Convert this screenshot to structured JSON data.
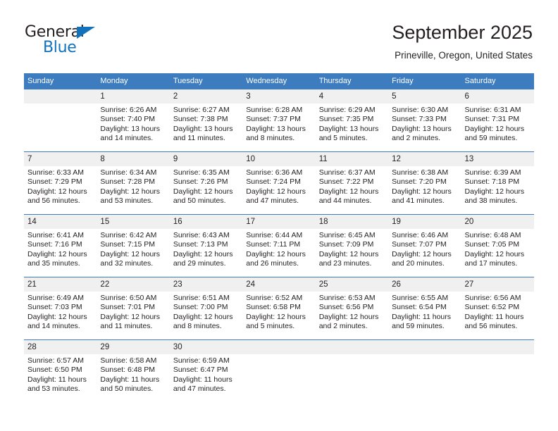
{
  "brand": {
    "name_top": "General",
    "name_bottom": "Blue",
    "accent_color": "#1272bc"
  },
  "header": {
    "title": "September 2025",
    "location": "Prineville, Oregon, United States"
  },
  "theme": {
    "header_bar_color": "#3d7cbe",
    "daynum_band_color": "#f0f0f0",
    "text_color": "#231f20"
  },
  "weekdays": [
    "Sunday",
    "Monday",
    "Tuesday",
    "Wednesday",
    "Thursday",
    "Friday",
    "Saturday"
  ],
  "weeks": [
    [
      {
        "day": "",
        "sunrise": "",
        "sunset": "",
        "daylight_line1": "",
        "daylight_line2": ""
      },
      {
        "day": "1",
        "sunrise": "Sunrise: 6:26 AM",
        "sunset": "Sunset: 7:40 PM",
        "daylight_line1": "Daylight: 13 hours",
        "daylight_line2": "and 14 minutes."
      },
      {
        "day": "2",
        "sunrise": "Sunrise: 6:27 AM",
        "sunset": "Sunset: 7:38 PM",
        "daylight_line1": "Daylight: 13 hours",
        "daylight_line2": "and 11 minutes."
      },
      {
        "day": "3",
        "sunrise": "Sunrise: 6:28 AM",
        "sunset": "Sunset: 7:37 PM",
        "daylight_line1": "Daylight: 13 hours",
        "daylight_line2": "and 8 minutes."
      },
      {
        "day": "4",
        "sunrise": "Sunrise: 6:29 AM",
        "sunset": "Sunset: 7:35 PM",
        "daylight_line1": "Daylight: 13 hours",
        "daylight_line2": "and 5 minutes."
      },
      {
        "day": "5",
        "sunrise": "Sunrise: 6:30 AM",
        "sunset": "Sunset: 7:33 PM",
        "daylight_line1": "Daylight: 13 hours",
        "daylight_line2": "and 2 minutes."
      },
      {
        "day": "6",
        "sunrise": "Sunrise: 6:31 AM",
        "sunset": "Sunset: 7:31 PM",
        "daylight_line1": "Daylight: 12 hours",
        "daylight_line2": "and 59 minutes."
      }
    ],
    [
      {
        "day": "7",
        "sunrise": "Sunrise: 6:33 AM",
        "sunset": "Sunset: 7:29 PM",
        "daylight_line1": "Daylight: 12 hours",
        "daylight_line2": "and 56 minutes."
      },
      {
        "day": "8",
        "sunrise": "Sunrise: 6:34 AM",
        "sunset": "Sunset: 7:28 PM",
        "daylight_line1": "Daylight: 12 hours",
        "daylight_line2": "and 53 minutes."
      },
      {
        "day": "9",
        "sunrise": "Sunrise: 6:35 AM",
        "sunset": "Sunset: 7:26 PM",
        "daylight_line1": "Daylight: 12 hours",
        "daylight_line2": "and 50 minutes."
      },
      {
        "day": "10",
        "sunrise": "Sunrise: 6:36 AM",
        "sunset": "Sunset: 7:24 PM",
        "daylight_line1": "Daylight: 12 hours",
        "daylight_line2": "and 47 minutes."
      },
      {
        "day": "11",
        "sunrise": "Sunrise: 6:37 AM",
        "sunset": "Sunset: 7:22 PM",
        "daylight_line1": "Daylight: 12 hours",
        "daylight_line2": "and 44 minutes."
      },
      {
        "day": "12",
        "sunrise": "Sunrise: 6:38 AM",
        "sunset": "Sunset: 7:20 PM",
        "daylight_line1": "Daylight: 12 hours",
        "daylight_line2": "and 41 minutes."
      },
      {
        "day": "13",
        "sunrise": "Sunrise: 6:39 AM",
        "sunset": "Sunset: 7:18 PM",
        "daylight_line1": "Daylight: 12 hours",
        "daylight_line2": "and 38 minutes."
      }
    ],
    [
      {
        "day": "14",
        "sunrise": "Sunrise: 6:41 AM",
        "sunset": "Sunset: 7:16 PM",
        "daylight_line1": "Daylight: 12 hours",
        "daylight_line2": "and 35 minutes."
      },
      {
        "day": "15",
        "sunrise": "Sunrise: 6:42 AM",
        "sunset": "Sunset: 7:15 PM",
        "daylight_line1": "Daylight: 12 hours",
        "daylight_line2": "and 32 minutes."
      },
      {
        "day": "16",
        "sunrise": "Sunrise: 6:43 AM",
        "sunset": "Sunset: 7:13 PM",
        "daylight_line1": "Daylight: 12 hours",
        "daylight_line2": "and 29 minutes."
      },
      {
        "day": "17",
        "sunrise": "Sunrise: 6:44 AM",
        "sunset": "Sunset: 7:11 PM",
        "daylight_line1": "Daylight: 12 hours",
        "daylight_line2": "and 26 minutes."
      },
      {
        "day": "18",
        "sunrise": "Sunrise: 6:45 AM",
        "sunset": "Sunset: 7:09 PM",
        "daylight_line1": "Daylight: 12 hours",
        "daylight_line2": "and 23 minutes."
      },
      {
        "day": "19",
        "sunrise": "Sunrise: 6:46 AM",
        "sunset": "Sunset: 7:07 PM",
        "daylight_line1": "Daylight: 12 hours",
        "daylight_line2": "and 20 minutes."
      },
      {
        "day": "20",
        "sunrise": "Sunrise: 6:48 AM",
        "sunset": "Sunset: 7:05 PM",
        "daylight_line1": "Daylight: 12 hours",
        "daylight_line2": "and 17 minutes."
      }
    ],
    [
      {
        "day": "21",
        "sunrise": "Sunrise: 6:49 AM",
        "sunset": "Sunset: 7:03 PM",
        "daylight_line1": "Daylight: 12 hours",
        "daylight_line2": "and 14 minutes."
      },
      {
        "day": "22",
        "sunrise": "Sunrise: 6:50 AM",
        "sunset": "Sunset: 7:01 PM",
        "daylight_line1": "Daylight: 12 hours",
        "daylight_line2": "and 11 minutes."
      },
      {
        "day": "23",
        "sunrise": "Sunrise: 6:51 AM",
        "sunset": "Sunset: 7:00 PM",
        "daylight_line1": "Daylight: 12 hours",
        "daylight_line2": "and 8 minutes."
      },
      {
        "day": "24",
        "sunrise": "Sunrise: 6:52 AM",
        "sunset": "Sunset: 6:58 PM",
        "daylight_line1": "Daylight: 12 hours",
        "daylight_line2": "and 5 minutes."
      },
      {
        "day": "25",
        "sunrise": "Sunrise: 6:53 AM",
        "sunset": "Sunset: 6:56 PM",
        "daylight_line1": "Daylight: 12 hours",
        "daylight_line2": "and 2 minutes."
      },
      {
        "day": "26",
        "sunrise": "Sunrise: 6:55 AM",
        "sunset": "Sunset: 6:54 PM",
        "daylight_line1": "Daylight: 11 hours",
        "daylight_line2": "and 59 minutes."
      },
      {
        "day": "27",
        "sunrise": "Sunrise: 6:56 AM",
        "sunset": "Sunset: 6:52 PM",
        "daylight_line1": "Daylight: 11 hours",
        "daylight_line2": "and 56 minutes."
      }
    ],
    [
      {
        "day": "28",
        "sunrise": "Sunrise: 6:57 AM",
        "sunset": "Sunset: 6:50 PM",
        "daylight_line1": "Daylight: 11 hours",
        "daylight_line2": "and 53 minutes."
      },
      {
        "day": "29",
        "sunrise": "Sunrise: 6:58 AM",
        "sunset": "Sunset: 6:48 PM",
        "daylight_line1": "Daylight: 11 hours",
        "daylight_line2": "and 50 minutes."
      },
      {
        "day": "30",
        "sunrise": "Sunrise: 6:59 AM",
        "sunset": "Sunset: 6:47 PM",
        "daylight_line1": "Daylight: 11 hours",
        "daylight_line2": "and 47 minutes."
      },
      {
        "day": "",
        "sunrise": "",
        "sunset": "",
        "daylight_line1": "",
        "daylight_line2": ""
      },
      {
        "day": "",
        "sunrise": "",
        "sunset": "",
        "daylight_line1": "",
        "daylight_line2": ""
      },
      {
        "day": "",
        "sunrise": "",
        "sunset": "",
        "daylight_line1": "",
        "daylight_line2": ""
      },
      {
        "day": "",
        "sunrise": "",
        "sunset": "",
        "daylight_line1": "",
        "daylight_line2": ""
      }
    ]
  ]
}
